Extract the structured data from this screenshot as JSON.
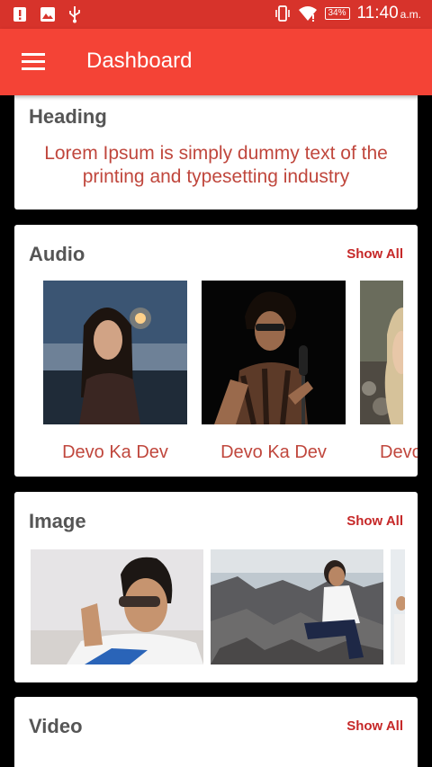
{
  "status_bar": {
    "time": "11:40",
    "ampm": "a.m.",
    "battery": "34%"
  },
  "app_bar": {
    "title": "Dashboard"
  },
  "heading_card": {
    "title": "Heading",
    "description": "Lorem Ipsum is simply dummy text of the printing and typesetting industry"
  },
  "audio": {
    "title": "Audio",
    "show_all": "Show All",
    "items": [
      {
        "caption": "Devo Ka Dev"
      },
      {
        "caption": "Devo Ka Dev"
      },
      {
        "caption": "Devo Ka Dev"
      }
    ]
  },
  "image": {
    "title": "Image",
    "show_all": "Show All"
  },
  "video": {
    "title": "Video",
    "show_all": "Show All"
  },
  "colors": {
    "status_bar": "#d7332b",
    "app_bar": "#f44336",
    "accent_text": "#c0473d",
    "show_all": "#c62828"
  }
}
